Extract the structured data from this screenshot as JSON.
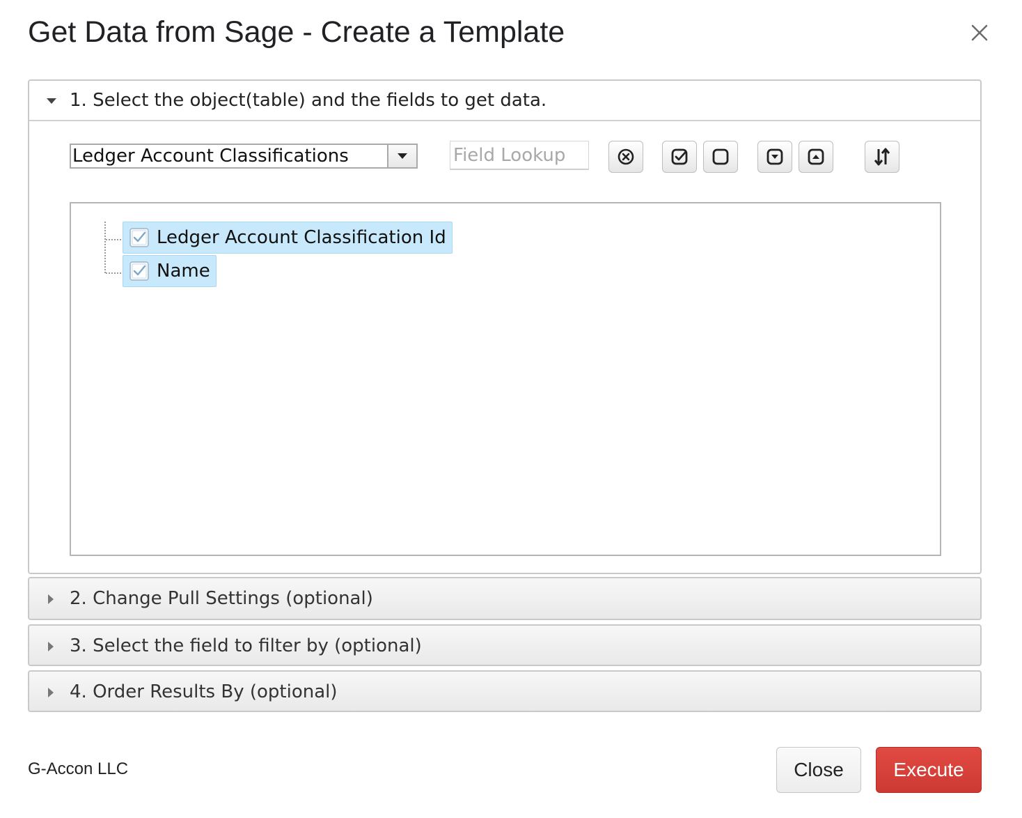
{
  "dialog": {
    "title": "Get Data from Sage - Create a Template",
    "close_icon": "close-icon"
  },
  "sections": [
    {
      "label": "1. Select the object(table) and the fields to get data.",
      "expanded": true
    },
    {
      "label": "2. Change Pull Settings (optional)",
      "expanded": false
    },
    {
      "label": "3. Select the field to filter by (optional)",
      "expanded": false
    },
    {
      "label": "4. Order Results By (optional)",
      "expanded": false
    }
  ],
  "object_select": {
    "value": "Ledger Account Classifications"
  },
  "field_lookup": {
    "placeholder": "Field Lookup",
    "value": ""
  },
  "toolbar": {
    "icons": [
      "clear-icon",
      "check-all-icon",
      "uncheck-all-icon",
      "expand-icon",
      "collapse-icon",
      "sort-icon"
    ]
  },
  "fields": [
    {
      "label": "Ledger Account Classification Id",
      "checked": true
    },
    {
      "label": "Name",
      "checked": true
    }
  ],
  "footer": {
    "company": "G-Accon LLC",
    "close_label": "Close",
    "execute_label": "Execute"
  },
  "colors": {
    "execute": "#cc3a33",
    "selected_node": "#c8e9fb"
  }
}
